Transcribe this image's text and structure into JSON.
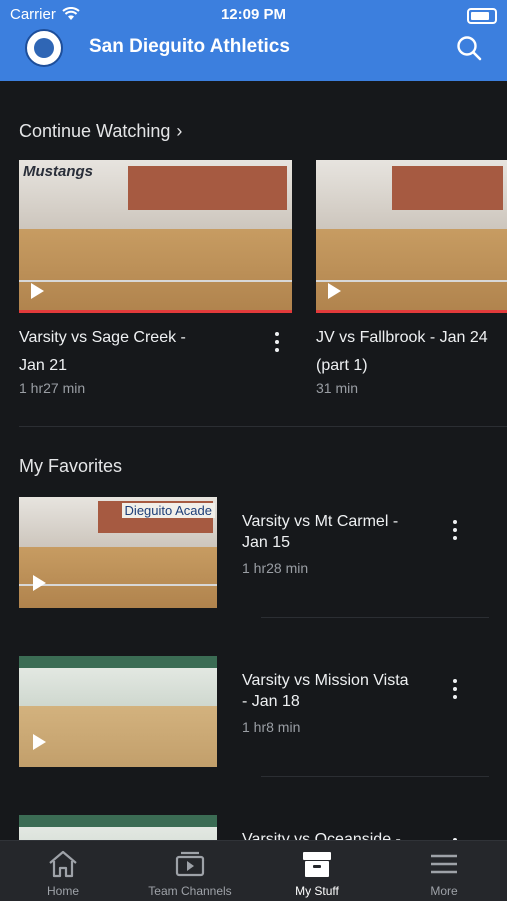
{
  "status_bar": {
    "carrier": "Carrier",
    "time": "12:09 PM"
  },
  "header": {
    "title": "San Dieguito Athletics"
  },
  "continue_watching": {
    "title": "Continue Watching",
    "items": [
      {
        "title_line1": "Varsity vs Sage Creek -",
        "title_line2": "Jan 21",
        "duration": "1 hr27 min",
        "banner": "Mustangs"
      },
      {
        "title_line1": "JV vs Fallbrook - Jan 24",
        "title_line2": "(part 1)",
        "duration": "31 min"
      }
    ]
  },
  "favorites": {
    "title": "My Favorites",
    "items": [
      {
        "title_line1": "Varsity vs Mt Carmel -",
        "title_line2": "Jan 15",
        "duration": "1 hr28 min",
        "banner": "Dieguito Acade"
      },
      {
        "title_line1": "Varsity vs Mission Vista",
        "title_line2": "- Jan 18",
        "duration": "1 hr8 min"
      },
      {
        "title_line1": "Varsity vs Oceanside -",
        "title_line2": "",
        "duration": ""
      }
    ]
  },
  "tabs": [
    {
      "label": "Home",
      "icon": "home-icon"
    },
    {
      "label": "Team Channels",
      "icon": "tv-icon"
    },
    {
      "label": "My Stuff",
      "icon": "archive-icon",
      "active": true
    },
    {
      "label": "More",
      "icon": "menu-icon"
    }
  ],
  "colors": {
    "header": "#3c7fde",
    "background": "#16181b",
    "tabbar": "#25272b",
    "progress": "#e23b3b"
  }
}
